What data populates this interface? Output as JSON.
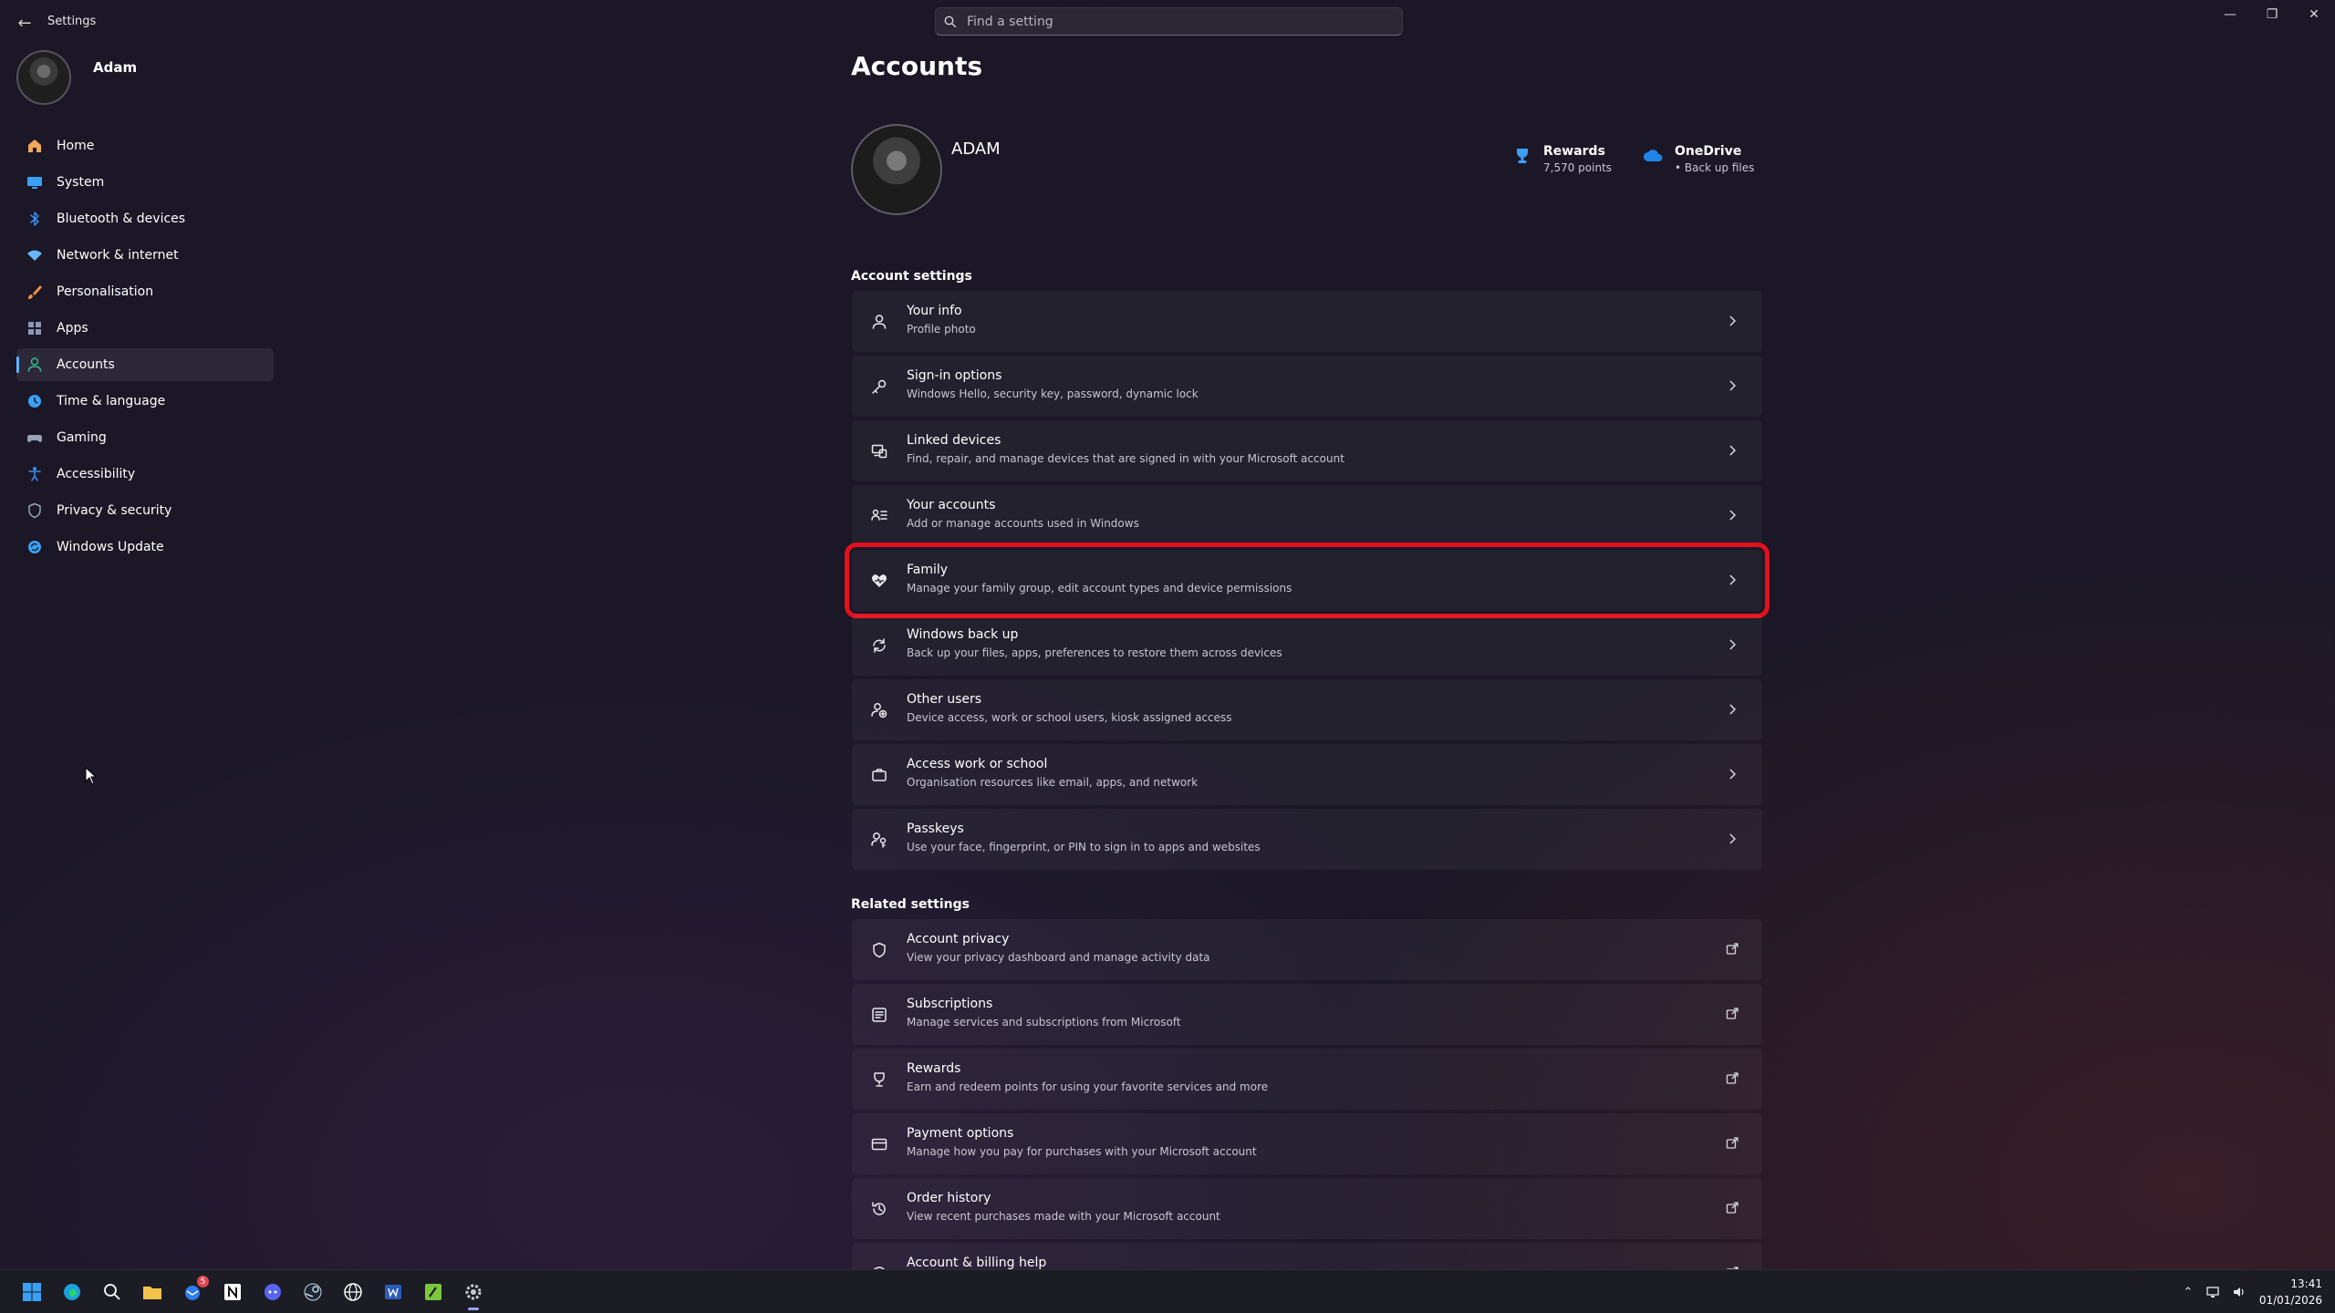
{
  "window": {
    "title": "Settings",
    "back_glyph": "←",
    "minimize_glyph": "—",
    "restore_glyph": "❐",
    "close_glyph": "✕"
  },
  "search": {
    "placeholder": "Find a setting",
    "value": ""
  },
  "profile": {
    "name": "Adam"
  },
  "nav": {
    "items": [
      {
        "label": "Home",
        "icon": "home-icon",
        "color": "#f0a85b"
      },
      {
        "label": "System",
        "icon": "monitor-icon",
        "color": "#3aa0f5"
      },
      {
        "label": "Bluetooth & devices",
        "icon": "bluetooth-icon",
        "color": "#3a8ef0"
      },
      {
        "label": "Network & internet",
        "icon": "wifi-icon",
        "color": "#69b7f5"
      },
      {
        "label": "Personalisation",
        "icon": "brush-icon",
        "color": "#f29340"
      },
      {
        "label": "Apps",
        "icon": "apps-icon",
        "color": "#8c97b8"
      },
      {
        "label": "Accounts",
        "icon": "person-icon",
        "color": "#34c08b",
        "active": true
      },
      {
        "label": "Time & language",
        "icon": "globe-clock-icon",
        "color": "#3aa0f5"
      },
      {
        "label": "Gaming",
        "icon": "gamepad-icon",
        "color": "#9aa3b5"
      },
      {
        "label": "Accessibility",
        "icon": "accessibility-icon",
        "color": "#3a8ef0"
      },
      {
        "label": "Privacy & security",
        "icon": "shield-icon",
        "color": "#9aa3b5"
      },
      {
        "label": "Windows Update",
        "icon": "update-icon",
        "color": "#3aa0f5"
      }
    ]
  },
  "main": {
    "title": "Accounts",
    "account_name": "ADAM",
    "rewards": {
      "title": "Rewards",
      "subtitle": "7,570 points"
    },
    "onedrive": {
      "title": "OneDrive",
      "subtitle": "• Back up files"
    },
    "account_settings": {
      "heading": "Account settings",
      "items": [
        {
          "title": "Your info",
          "subtitle": "Profile photo",
          "icon": "person-icon"
        },
        {
          "title": "Sign-in options",
          "subtitle": "Windows Hello, security key, password, dynamic lock",
          "icon": "key-icon"
        },
        {
          "title": "Linked devices",
          "subtitle": "Find, repair, and manage devices that are signed in with your Microsoft account",
          "icon": "linked-devices-icon"
        },
        {
          "title": "Your accounts",
          "subtitle": "Add or manage accounts used in Windows",
          "icon": "accounts-list-icon"
        },
        {
          "title": "Family",
          "subtitle": "Manage your family group, edit account types and device permissions",
          "icon": "family-heart-icon",
          "highlighted": true
        },
        {
          "title": "Windows back up",
          "subtitle": "Back up your files, apps, preferences to restore them across devices",
          "icon": "backup-icon"
        },
        {
          "title": "Other users",
          "subtitle": "Device access, work or school users, kiosk assigned access",
          "icon": "add-user-icon"
        },
        {
          "title": "Access work or school",
          "subtitle": "Organisation resources like email, apps, and network",
          "icon": "briefcase-icon"
        },
        {
          "title": "Passkeys",
          "subtitle": "Use your face, fingerprint, or PIN to sign in to apps and websites",
          "icon": "passkey-icon"
        }
      ]
    },
    "related_settings": {
      "heading": "Related settings",
      "items": [
        {
          "title": "Account privacy",
          "subtitle": "View your privacy dashboard and manage activity data",
          "icon": "shield-icon"
        },
        {
          "title": "Subscriptions",
          "subtitle": "Manage services and subscriptions from Microsoft",
          "icon": "subscriptions-icon"
        },
        {
          "title": "Rewards",
          "subtitle": "Earn and redeem points for using your favorite services and more",
          "icon": "trophy-icon"
        },
        {
          "title": "Payment options",
          "subtitle": "Manage how you pay for purchases with your Microsoft account",
          "icon": "credit-card-icon"
        },
        {
          "title": "Order history",
          "subtitle": "View recent purchases made with your Microsoft account",
          "icon": "history-icon"
        },
        {
          "title": "Account & billing help",
          "subtitle": "",
          "icon": "help-icon"
        }
      ]
    }
  },
  "taskbar": {
    "apps": [
      "start-icon",
      "edge-icon",
      "search-icon",
      "file-explorer-icon",
      "thunderbird-icon",
      "notion-icon",
      "discord-icon",
      "steam-icon",
      "globe-app-icon",
      "word-icon",
      "app-green-icon",
      "settings-gear-icon"
    ],
    "badges": {
      "thunderbird-icon": "5"
    },
    "time": "13:41",
    "date": "01/01/2026"
  },
  "colors": {
    "accent": "#5fb2ff",
    "highlight": "#e3101d",
    "background": "#1b1726",
    "card": "#25212f"
  }
}
